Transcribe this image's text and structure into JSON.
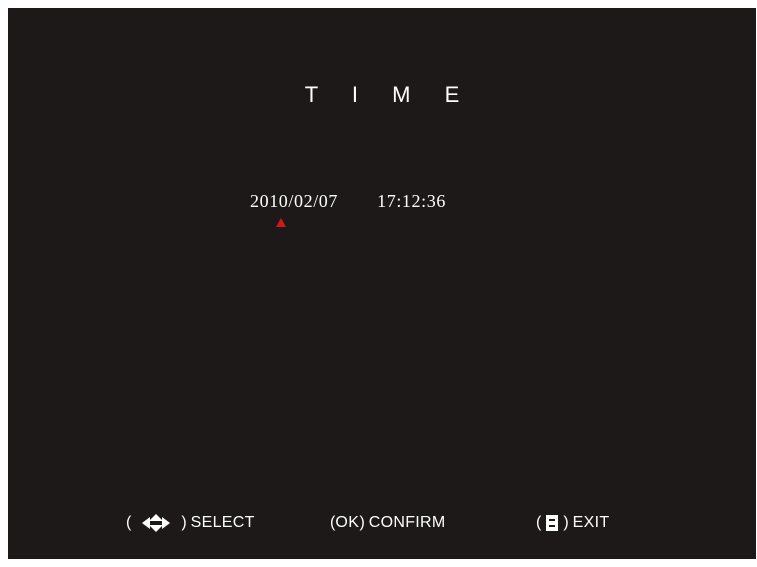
{
  "screen": {
    "title": "T I M E",
    "date": "2010/02/07",
    "time": "17:12:36"
  },
  "footer": {
    "select_label": "SELECT",
    "confirm_key": "OK",
    "confirm_label": "CONFIRM",
    "exit_label": "EXIT",
    "paren_open": "(",
    "paren_close": ")"
  },
  "icons": {
    "select": "arrows-icon",
    "exit": "menu-icon",
    "cursor": "red-triangle-cursor-icon"
  },
  "colors": {
    "background": "#1d1918",
    "text": "#ffffff",
    "cursor": "#d01818"
  }
}
